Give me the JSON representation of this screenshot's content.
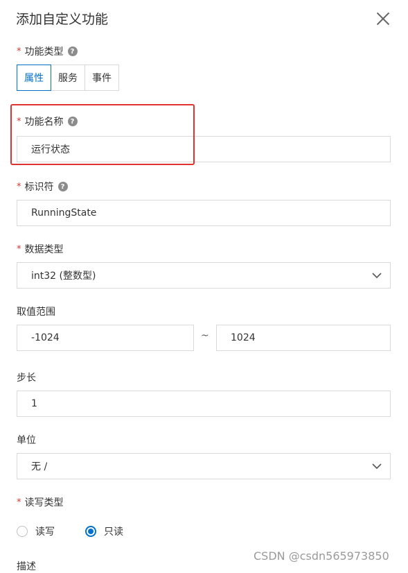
{
  "dialog": {
    "title": "添加自定义功能"
  },
  "fields": {
    "function_type": {
      "label": "功能类型",
      "required_mark": "*",
      "options": [
        "属性",
        "服务",
        "事件"
      ],
      "selected": "属性"
    },
    "function_name": {
      "label": "功能名称",
      "required_mark": "*",
      "value": "运行状态"
    },
    "identifier": {
      "label": "标识符",
      "required_mark": "*",
      "value": "RunningState"
    },
    "data_type": {
      "label": "数据类型",
      "required_mark": "*",
      "value": "int32 (整数型)"
    },
    "value_range": {
      "label": "取值范围",
      "min": "-1024",
      "separator": "~",
      "max": "1024"
    },
    "step": {
      "label": "步长",
      "value": "1"
    },
    "unit": {
      "label": "单位",
      "value": "无 /"
    },
    "rw_type": {
      "label": "读写类型",
      "required_mark": "*",
      "options": [
        "读写",
        "只读"
      ],
      "selected": "只读"
    },
    "description": {
      "label": "描述"
    }
  },
  "help_glyph": "?",
  "watermark": "CSDN @csdn565973850",
  "colors": {
    "accent": "#0070cc",
    "required": "#e0332f",
    "highlight_box": "#e0332f"
  }
}
